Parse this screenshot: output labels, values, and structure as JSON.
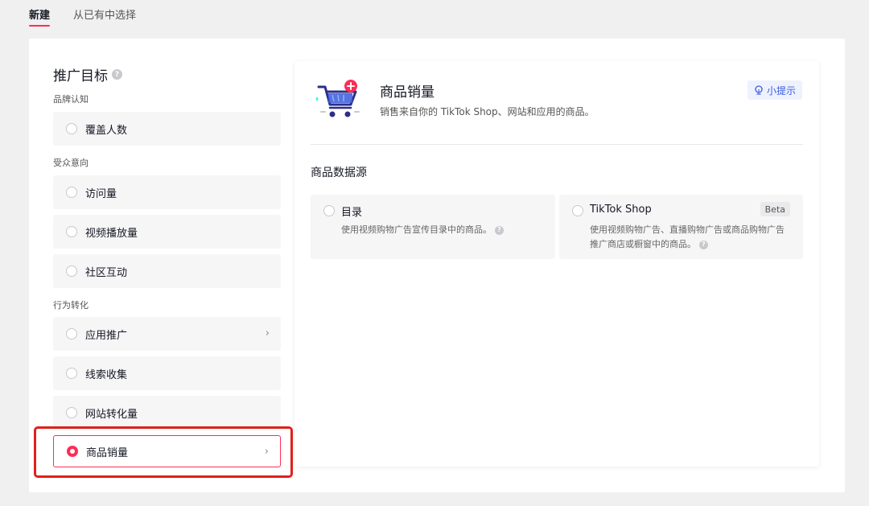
{
  "tabs": [
    {
      "label": "新建",
      "active": true
    },
    {
      "label": "从已有中选择",
      "active": false
    }
  ],
  "left": {
    "title": "推广目标",
    "groups": [
      {
        "label": "品牌认知",
        "options": [
          {
            "label": "覆盖人数"
          }
        ]
      },
      {
        "label": "受众意向",
        "options": [
          {
            "label": "访问量"
          },
          {
            "label": "视频播放量"
          },
          {
            "label": "社区互动"
          }
        ]
      },
      {
        "label": "行为转化",
        "options": [
          {
            "label": "应用推广",
            "has_arrow": true
          },
          {
            "label": "线索收集"
          },
          {
            "label": "网站转化量"
          },
          {
            "label": "商品销量",
            "has_arrow": true,
            "selected": true
          }
        ]
      }
    ]
  },
  "right": {
    "title": "商品销量",
    "description": "销售来自你的 TikTok Shop、网站和应用的商品。",
    "tip_label": "小提示",
    "source_title": "商品数据源",
    "sources": [
      {
        "name": "目录",
        "description": "使用视频购物广告宣传目录中的商品。",
        "badge": ""
      },
      {
        "name": "TikTok Shop",
        "description": "使用视频购物广告、直播购物广告或商品购物广告推广商店或橱窗中的商品。",
        "badge": "Beta"
      }
    ]
  },
  "colors": {
    "accent": "#fe2c55",
    "highlight": "#e0201a",
    "tip": "#3b5bdb"
  }
}
